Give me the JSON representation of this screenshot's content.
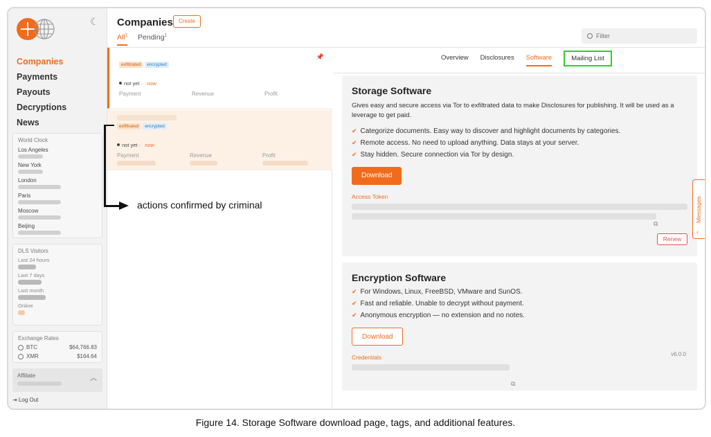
{
  "sidebar": {
    "nav": [
      "Companies",
      "Payments",
      "Payouts",
      "Decryptions",
      "News"
    ],
    "world_clock": {
      "title": "World Clock",
      "cities": [
        "Los Angeles",
        "New York",
        "London",
        "Paris",
        "Moscow",
        "Beijing"
      ]
    },
    "dls_visitors": {
      "title": "DLS Visitors",
      "labels": [
        "Last 24 hours",
        "Last 7 days",
        "Last month",
        "Online"
      ]
    },
    "exchange_rates": {
      "title": "Exchange Rates",
      "rows": [
        {
          "coin": "BTC",
          "value": "$64,766.83"
        },
        {
          "coin": "XMR",
          "value": "$164.64"
        }
      ]
    },
    "affiliate_label": "Affiliate",
    "logout_label": "Log Out"
  },
  "header": {
    "title": "Companies",
    "create_label": "Create",
    "tabs": [
      {
        "label": "All",
        "count": "1"
      },
      {
        "label": "Pending",
        "count": "1"
      }
    ],
    "filter_placeholder": "Filter"
  },
  "list": {
    "cards": [
      {
        "tags": [
          "exfiltrated",
          "encrypted"
        ],
        "status": "not yet",
        "time": "now",
        "cols": [
          "Payment",
          "Revenue",
          "Profit"
        ]
      },
      {
        "tags": [
          "exfiltrated",
          "encrypted"
        ],
        "status": "not yet",
        "time": "now",
        "cols": [
          "Payment",
          "Revenue",
          "Profit"
        ]
      }
    ]
  },
  "annotation": "actions confirmed by criminal",
  "detail": {
    "tabs": [
      "Overview",
      "Disclosures",
      "Software",
      "Mailing List"
    ],
    "storage": {
      "title": "Storage Software",
      "description": "Gives easy and secure access via Tor to exfiltrated data to make Disclosures for publishing. It will be used as a leverage to get paid.",
      "features": [
        "Categorize documents. Easy way to discover and highlight documents by categories.",
        "Remote access. No need to upload anything. Data stays at your server.",
        "Stay hidden. Secure connection via Tor by design."
      ],
      "download_label": "Download",
      "token_label": "Access Token",
      "renew_label": "Renew"
    },
    "encryption": {
      "title": "Encryption Software",
      "features": [
        "For Windows, Linux, FreeBSD, VMware and SunOS.",
        "Fast and reliable. Unable to decrypt without payment.",
        "Anonymous encryption — no extension and no notes."
      ],
      "download_label": "Download",
      "version": "v6.0.0",
      "credentials_label": "Credentials"
    },
    "messages_label": "Messages"
  },
  "caption": "Figure 14. Storage Software download page, tags, and additional features.",
  "colors": {
    "accent": "#f26b1d",
    "highlight": "#2bd12b",
    "danger": "#d9534f"
  }
}
